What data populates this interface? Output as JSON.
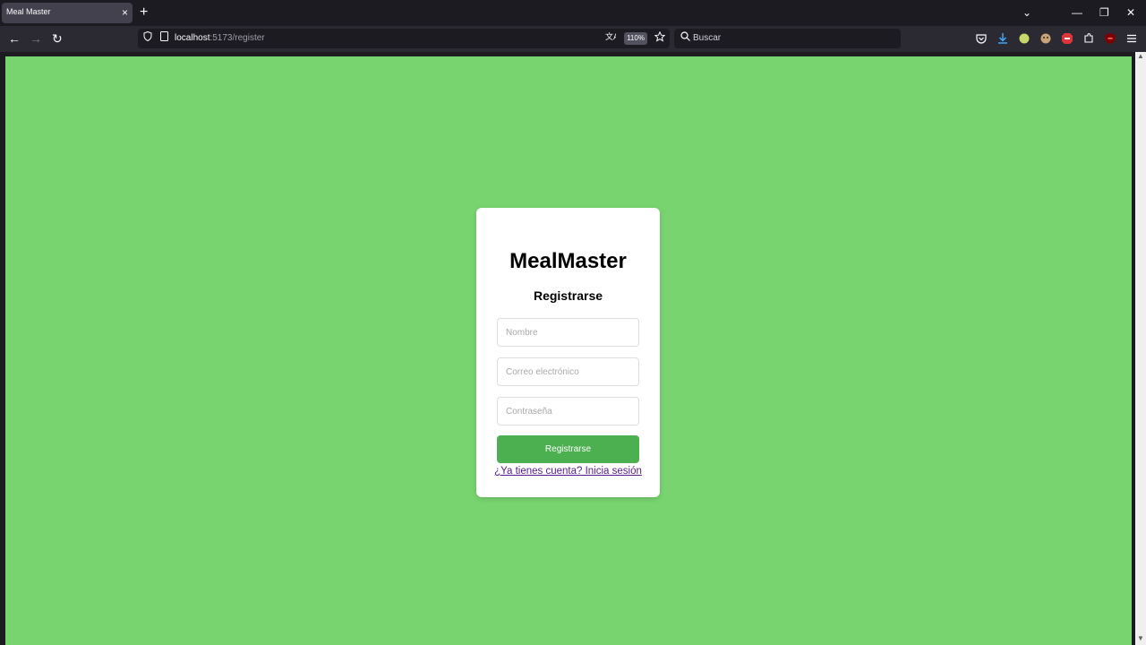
{
  "browser": {
    "tab_title": "Meal Master",
    "tab_close": "×",
    "new_tab": "+",
    "url_host": "localhost",
    "url_rest": ":5173/register",
    "zoom": "110%",
    "search_placeholder": "Buscar",
    "window_controls": {
      "list": "⌄",
      "minimize": "—",
      "restore": "❐",
      "close": "✕"
    },
    "nav": {
      "back": "←",
      "forward": "→",
      "reload": "↻"
    }
  },
  "page": {
    "app_title": "MealMaster",
    "form_title": "Registrarse",
    "fields": {
      "name_placeholder": "Nombre",
      "email_placeholder": "Correo electrónico",
      "password_placeholder": "Contraseña"
    },
    "submit_label": "Registrarse",
    "login_link": "¿Ya tienes cuenta? Inicia sesión"
  },
  "colors": {
    "page_background": "#78d46f",
    "button": "#4caf50",
    "link": "#551a8b"
  },
  "icons": [
    "shield-icon",
    "page-icon",
    "translate-icon",
    "star-icon",
    "search-icon",
    "pocket-icon",
    "download-icon",
    "extension-icon",
    "menu-icon"
  ]
}
